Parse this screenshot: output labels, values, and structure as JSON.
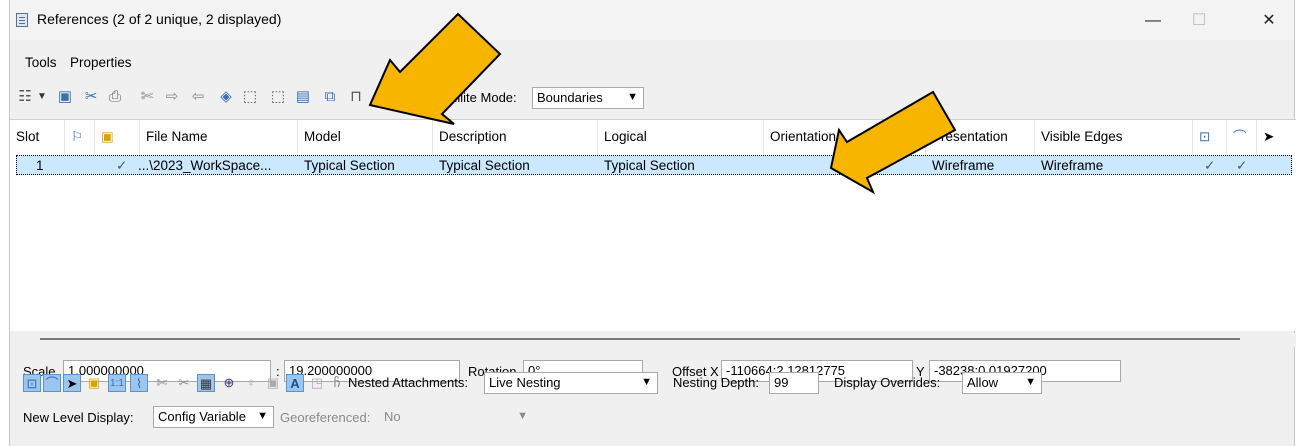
{
  "window": {
    "title": "References (2 of 2 unique, 2 displayed)",
    "minimize_glyph": "—",
    "maximize_glyph": "☐",
    "close_glyph": "✕"
  },
  "menu": [
    "Tools",
    "Properties"
  ],
  "toolbar": {
    "hilite_label": "Hilite Mode:",
    "hilite_value": "Boundaries"
  },
  "columns": [
    "Slot",
    "File Name",
    "Model",
    "Description",
    "Logical",
    "Orientation",
    "Presentation",
    "Visible Edges"
  ],
  "rows": [
    {
      "slot": "1",
      "check": "✓",
      "file_name": "...\\2023_WorkSpace...",
      "model": "Typical Section",
      "description": "Typical Section",
      "logical": "Typical Section",
      "orientation": "",
      "presentation": "Wireframe",
      "visible_edges": "Wireframe",
      "display_check": "✓",
      "snap_check": "✓"
    }
  ],
  "properties": {
    "scale_label": "Scale",
    "scale_value1": "1.000000000",
    "scale_sep": ":",
    "scale_value2": "19.200000000",
    "rotation_label": "Rotation",
    "rotation_value": "0°",
    "offset_x_label": "Offset X",
    "offset_x_value": "-110664:2.12812775",
    "y_label": "Y",
    "y_value": "-38238:0.01927200",
    "nested_label": "Nested Attachments:",
    "nested_value": "Live Nesting",
    "depth_label": "Nesting Depth:",
    "depth_value": "99",
    "overrides_label": "Display Overrides:",
    "overrides_value": "Allow",
    "new_level_label": "New Level Display:",
    "new_level_value": "Config Variable",
    "georef_label": "Georeferenced:",
    "georef_value": "No"
  },
  "colors": {
    "arrow_fill": "#f7b500",
    "arrow_stroke": "#000000",
    "selection": "#cce8ff"
  }
}
